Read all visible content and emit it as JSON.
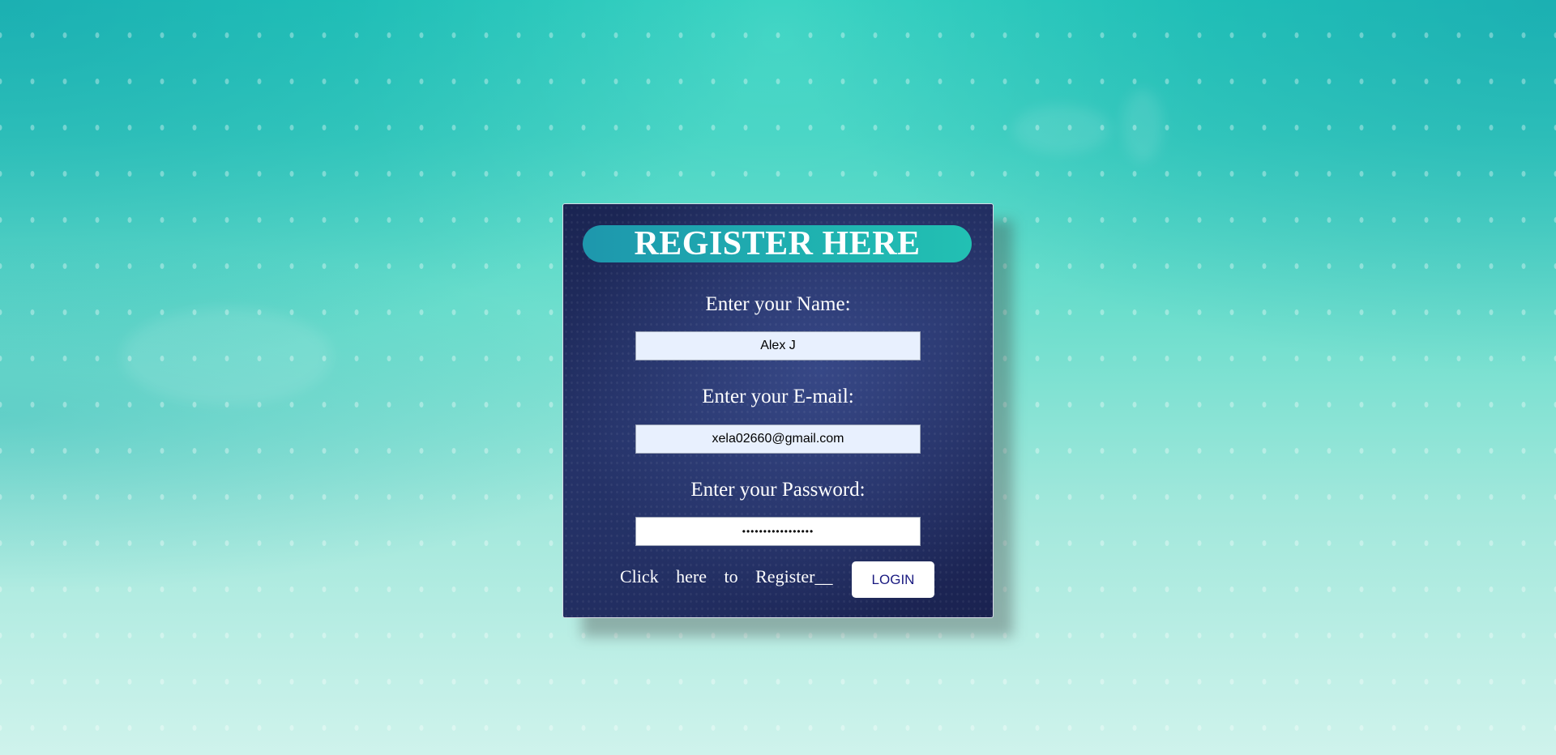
{
  "form": {
    "title": "REGISTER HERE",
    "name_label": "Enter your Name:",
    "name_value": "Alex J",
    "email_label": "Enter your E-mail:",
    "email_value": "xela02660@gmail.com",
    "password_label": "Enter your Password:",
    "password_value": "•••••••••••••••••",
    "register_link": "Click here to Register__",
    "login_label": "LOGIN"
  },
  "colors": {
    "card_background": "#1f2a5c",
    "title_pill": "#20aab0",
    "login_text": "#1a1a80"
  }
}
